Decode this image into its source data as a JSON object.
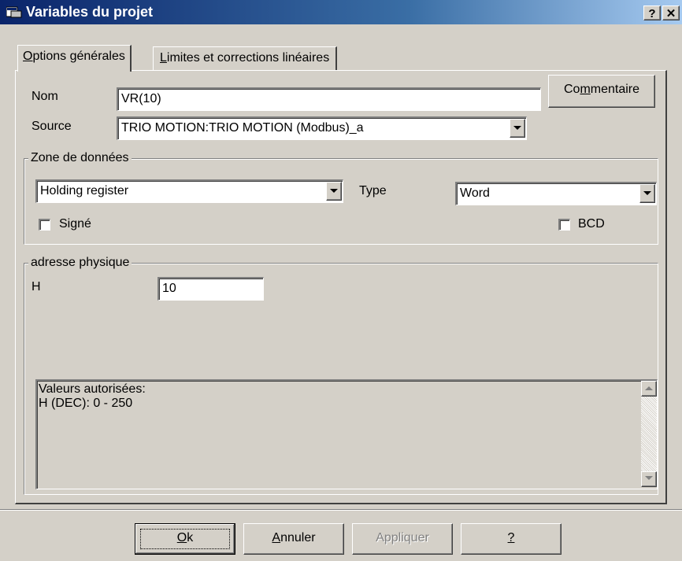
{
  "window": {
    "title": "Variables du projet",
    "help_button": "?",
    "close_button": "✕"
  },
  "tabs": [
    {
      "label": "Options générales",
      "mnemonic": "O",
      "rest": "ptions générales",
      "active": true
    },
    {
      "label": "Limites et corrections linéaires",
      "mnemonic": "L",
      "rest": "imites et corrections linéaires",
      "active": false
    }
  ],
  "form": {
    "name_label": "Nom",
    "name_value": "VR(10)",
    "comment_button_pre": "Co",
    "comment_button_mnemonic": "m",
    "comment_button_post": "mentaire",
    "source_label": "Source",
    "source_value": "TRIO MOTION:TRIO MOTION (Modbus)_a"
  },
  "data_zone": {
    "legend": "Zone de données",
    "zone_value": "Holding register",
    "type_label": "Type",
    "type_value": "Word",
    "signed_label": "Signé",
    "signed_checked": false,
    "bcd_label": "BCD",
    "bcd_checked": false
  },
  "physical_address": {
    "legend": "adresse physique",
    "h_label": "H",
    "h_value": "10",
    "allowed_line1": "Valeurs autorisées:",
    "allowed_line2": "H (DEC): 0 - 250"
  },
  "buttons": {
    "ok_mnemonic": "O",
    "ok_rest": "k",
    "cancel_mnemonic": "A",
    "cancel_rest": "nnuler",
    "apply_label": "Appliquer",
    "apply_enabled": false,
    "help_label": "?"
  },
  "colors": {
    "titlebar_start": "#0a246a",
    "titlebar_end": "#a6caf0",
    "face": "#d4d0c8"
  }
}
